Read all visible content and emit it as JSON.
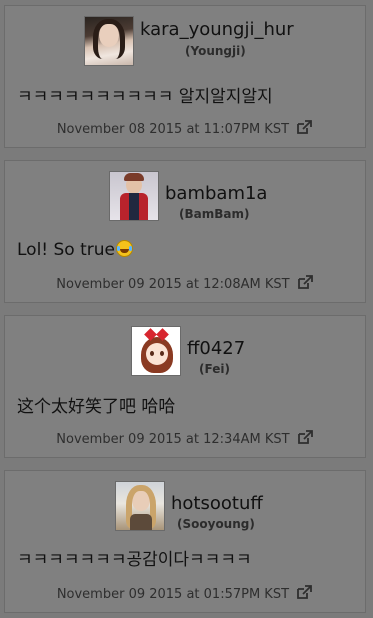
{
  "comments": [
    {
      "username": "kara_youngji_hur",
      "display_name": "(Youngji)",
      "message": "ㅋㅋㅋㅋㅋㅋㅋㅋㅋㅋ 알지알지알지",
      "timestamp": "November 08 2015 at 11:07PM KST",
      "avatar": "photo of woman with long dark hair"
    },
    {
      "username": "bambam1a",
      "display_name": "(BamBam)",
      "message": "Lol! So true",
      "emoji": "face-with-tears-of-joy",
      "timestamp": "November 09 2015 at 12:08AM KST",
      "avatar": "photo of man in red jacket"
    },
    {
      "username": "ff0427",
      "display_name": "(Fei)",
      "message": "这个太好笑了吧 哈哈",
      "timestamp": "November 09 2015 at 12:34AM KST",
      "avatar": "cartoon girl with red bow"
    },
    {
      "username": "hotsootuff",
      "display_name": "(Sooyoung)",
      "message": "ㅋㅋㅋㅋㅋㅋㅋ공감이다ㅋㅋㅋㅋ",
      "timestamp": "November 09 2015 at 01:57PM KST",
      "avatar": "photo of woman with blonde hair"
    }
  ],
  "icons": {
    "external_link": "external-link-icon"
  },
  "colors": {
    "page_background": "#7b7b7b",
    "card_background": "#808080",
    "text": "#111111",
    "meta_text": "#2e2e2e"
  }
}
